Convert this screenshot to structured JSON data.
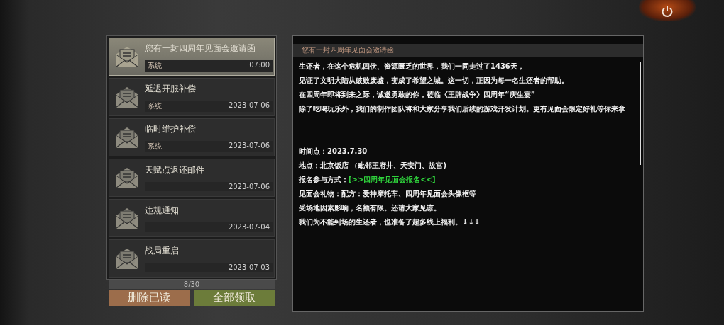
{
  "mails": [
    {
      "title": "您有一封四周年见面会邀请函",
      "sender": "系统",
      "date": "07:00",
      "selected": true
    },
    {
      "title": "延迟开服补偿",
      "sender": "系统",
      "date": "2023-07-06",
      "selected": false
    },
    {
      "title": "临时维护补偿",
      "sender": "系统",
      "date": "2023-07-06",
      "selected": false
    },
    {
      "title": "天赋点返还邮件",
      "date": "2023-07-06",
      "selected": false
    },
    {
      "title": "违规通知",
      "date": "2023-07-04",
      "selected": false
    },
    {
      "title": "战局重启",
      "date": "2023-07-03",
      "selected": false
    }
  ],
  "counter": "8/30",
  "buttons": [
    {
      "label": "删除已读",
      "kind": "delete"
    },
    {
      "label": "全部领取",
      "kind": "claim"
    }
  ],
  "message": {
    "title": "您有一封四周年见面会邀请函",
    "lines": [
      {
        "kind": "text",
        "text": "生还者，在这个危机四伏、资源匮乏的世界，我们一同走过了1436天，"
      },
      {
        "kind": "text",
        "text": "见证了文明大陆从破败废墟，变成了希望之城。这一切，正因为每一名生还者的帮助。"
      },
      {
        "kind": "text",
        "text": "在四周年即将到来之际，诚邀勇敢的你，莅临《王牌战争》四周年“庆生宴”"
      },
      {
        "kind": "text",
        "text": "除了吃喝玩乐外，我们的制作团队将和大家分享我们后续的游戏开发计划。更有见面会限定好礼等你来拿"
      },
      {
        "kind": "blank"
      },
      {
        "kind": "text",
        "text": "时间点：2023.7.30"
      },
      {
        "kind": "text",
        "text": "地点：北京饭店 （毗邻王府井、天安门、故宫)"
      },
      {
        "kind": "link",
        "text": "报名参与方式：",
        "link": "[>>四周年见面会报名<<]"
      },
      {
        "kind": "text",
        "text": "见面会礼物：配方：爱神摩托车、四周年见面会头像框等"
      },
      {
        "kind": "text",
        "text": "受场地因素影响，名额有限。还请大家见谅。"
      },
      {
        "kind": "text",
        "text": "我们为不能到场的生还者，也准备了超多线上福利。↓↓↓"
      }
    ]
  }
}
